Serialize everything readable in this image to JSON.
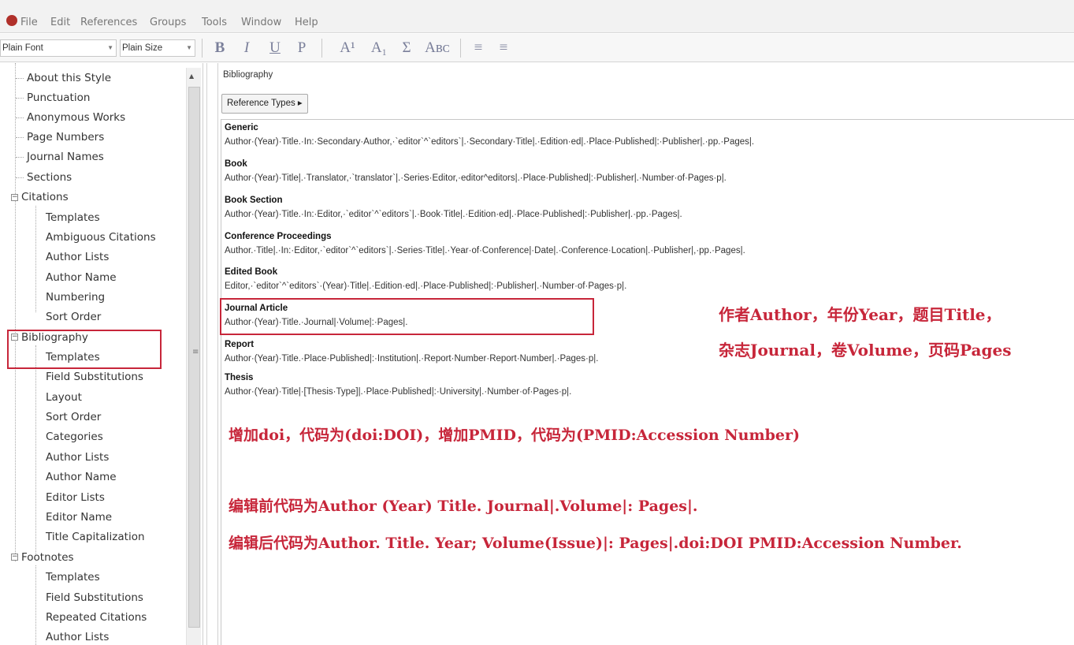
{
  "menubar": {
    "items": [
      "File",
      "Edit",
      "References",
      "Groups",
      "Tools",
      "Window",
      "Help"
    ]
  },
  "toolbar": {
    "font_select": "Plain Font",
    "size_select": "Plain Size",
    "buttons": [
      "B",
      "I",
      "U",
      "P",
      "A¹",
      "A₁",
      "Σ",
      "Aʙᴄ",
      "≡",
      "≡"
    ]
  },
  "tree": {
    "items": [
      "About this Style",
      "Punctuation",
      "Anonymous Works",
      "Page Numbers",
      "Journal Names",
      "Sections",
      "Citations",
      "Templates",
      "Ambiguous Citations",
      "Author Lists",
      "Author Name",
      "Numbering",
      "Sort Order",
      "Bibliography",
      "Templates",
      "Field Substitutions",
      "Layout",
      "Sort Order",
      "Categories",
      "Author Lists",
      "Author Name",
      "Editor Lists",
      "Editor Name",
      "Title Capitalization",
      "Footnotes",
      "Templates",
      "Field Substitutions",
      "Repeated Citations",
      "Author Lists"
    ]
  },
  "content": {
    "section_title": "Bibliography",
    "ref_types_button": "Reference Types ▸",
    "reference_types": [
      {
        "name": "Generic",
        "template": "Author·(Year)·Title.·In:·Secondary·Author,·`editor`^`editors`|.·Secondary·Title|.·Edition·ed|.·Place·Published|:·Publisher|.·pp.·Pages|."
      },
      {
        "name": "Book",
        "template": "Author·(Year)·Title|.·Translator,·`translator`|.·Series·Editor,·editor^editors|.·Place·Published|:·Publisher|.·Number·of·Pages·p|."
      },
      {
        "name": "Book Section",
        "template": "Author·(Year)·Title.·In:·Editor,·`editor`^`editors`|.·Book·Title|.·Edition·ed|.·Place·Published|:·Publisher|.·pp.·Pages|."
      },
      {
        "name": "Conference Proceedings",
        "template": "Author.·Title|.·In:·Editor,·`editor`^`editors`|.·Series·Title|.·Year·of·Conference|·Date|.·Conference·Location|.·Publisher|,·pp.·Pages|."
      },
      {
        "name": "Edited Book",
        "template": "Editor,·`editor`^`editors`·(Year)·Title|.·Edition·ed|.·Place·Published|:·Publisher|.·Number·of·Pages·p|."
      },
      {
        "name": "Journal Article",
        "template": "Author·(Year)·Title.·Journal|·Volume|:·Pages|."
      },
      {
        "name": "Report",
        "template": "Author·(Year)·Title.·Place·Published|:·Institution|.·Report·Number·Report·Number|.·Pages·p|."
      },
      {
        "name": "Thesis",
        "template": "Author·(Year)·Title|·[Thesis·Type]|.·Place·Published|:·University|.·Number·of·Pages·p|."
      }
    ]
  },
  "annotations": {
    "line1": "作者Author，年份Year，题目Title，",
    "line2": "杂志Journal，卷Volume，页码Pages",
    "line3": "增加doi，代码为(doi:DOI)，增加PMID，代码为(PMID:Accession Number)",
    "line4": "编辑前代码为Author (Year) Title. Journal|.Volume|: Pages|.",
    "line5": "编辑后代码为Author. Title. Year; Volume(Issue)|: Pages|.doi:DOI PMID:Accession Number."
  },
  "colors": {
    "annotation_red": "#c7263a",
    "toolbar_glyph": "#7a7f9a"
  }
}
